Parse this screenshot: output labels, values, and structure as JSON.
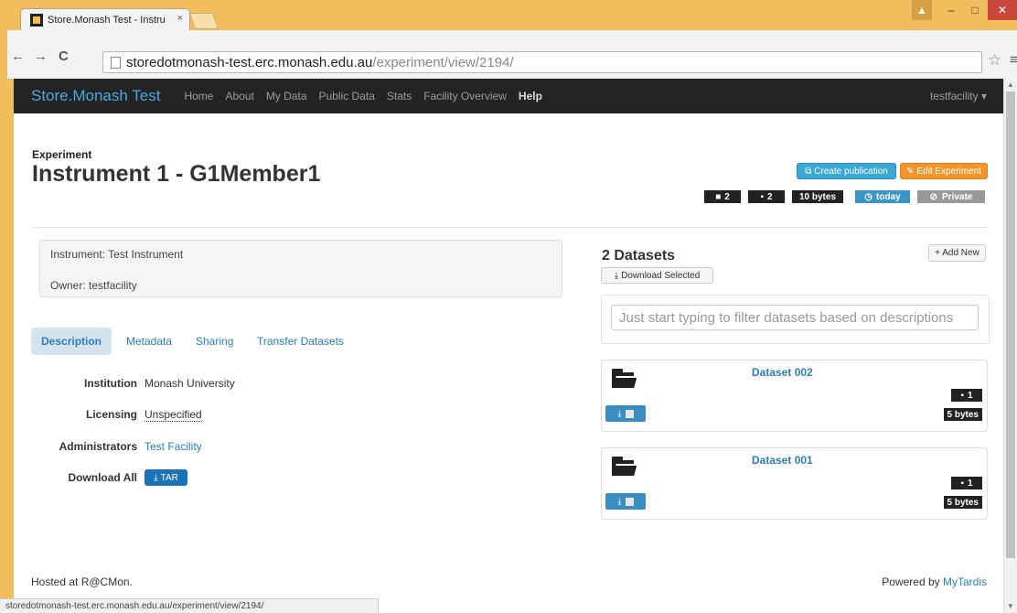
{
  "browser": {
    "tab_title": "Store.Monash Test - Instru",
    "tab_close": "×",
    "url_domain": "storedotmonash-test.erc.monash.edu.au",
    "url_path": "/experiment/view/2194/",
    "status_url": "storedotmonash-test.erc.monash.edu.au/experiment/view/2194/"
  },
  "navbar": {
    "brand": "Store.Monash Test",
    "links": [
      "Home",
      "About",
      "My Data",
      "Public Data",
      "Stats",
      "Facility Overview",
      "Help"
    ],
    "user": "testfacility ▾"
  },
  "header": {
    "label": "Experiment",
    "title": "Instrument 1 - G1Member1",
    "create_publication": "Create publication",
    "edit_experiment": "Edit Experiment",
    "badges": {
      "datasets": "2",
      "files": "2",
      "size": "10 bytes",
      "date": "today",
      "visibility": "Private"
    }
  },
  "info": {
    "instrument": "Instrument: Test Instrument",
    "owner": "Owner: testfacility"
  },
  "tabs": [
    "Description",
    "Metadata",
    "Sharing",
    "Transfer Datasets"
  ],
  "details": {
    "institution_label": "Institution",
    "institution": "Monash University",
    "licensing_label": "Licensing",
    "licensing": "Unspecified",
    "administrators_label": "Administrators",
    "administrators": "Test Facility",
    "download_all_label": "Download All",
    "tar": "TAR"
  },
  "datasets": {
    "title": "2 Datasets",
    "add_new": "+ Add New",
    "download_selected": "Download Selected",
    "filter_placeholder": "Just start typing to filter datasets based on descriptions",
    "items": [
      {
        "name": "Dataset 002",
        "files": "1",
        "size": "5 bytes"
      },
      {
        "name": "Dataset 001",
        "files": "1",
        "size": "5 bytes"
      }
    ]
  },
  "footer": {
    "hosted": "Hosted at R@CMon.",
    "powered_prefix": "Powered by",
    "powered_link": "MyTardis"
  }
}
